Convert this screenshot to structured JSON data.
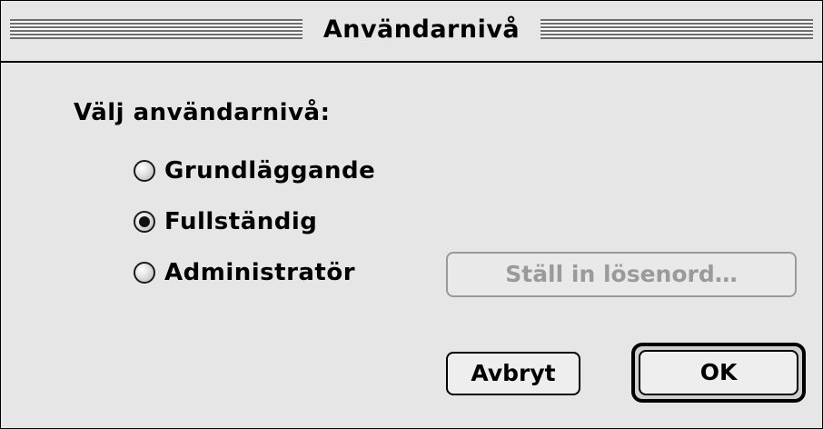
{
  "window": {
    "title": "Användarnivå"
  },
  "prompt": "Välj användarnivå:",
  "options": [
    {
      "label": "Grundläggande",
      "selected": false
    },
    {
      "label": "Fullständig",
      "selected": true
    },
    {
      "label": "Administratör",
      "selected": false
    }
  ],
  "buttons": {
    "set_password": "Ställ in lösenord…",
    "set_password_enabled": false,
    "cancel": "Avbryt",
    "ok": "OK"
  }
}
